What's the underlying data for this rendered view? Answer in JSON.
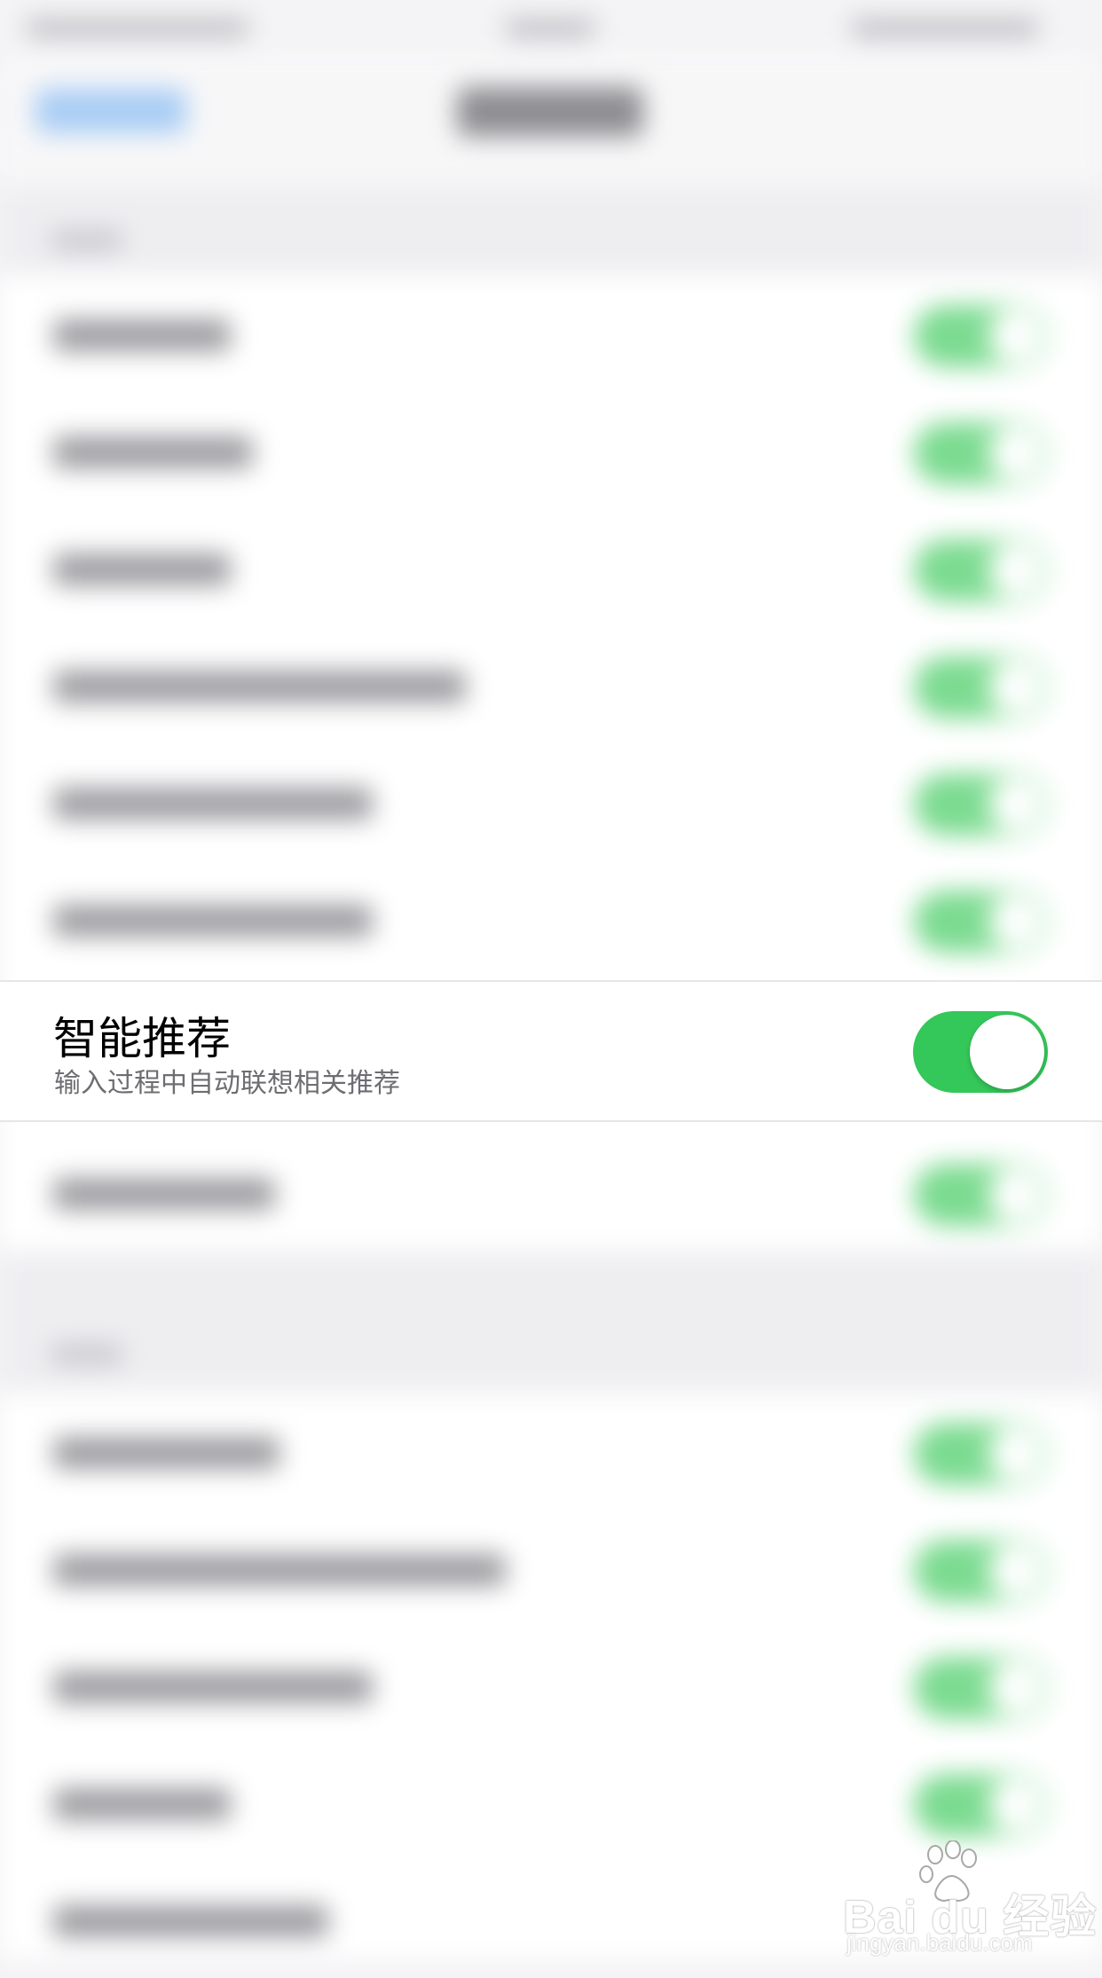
{
  "focused_setting": {
    "title": "智能推荐",
    "subtitle": "输入过程中自动联想相关推荐",
    "toggle_on": true
  },
  "colors": {
    "toggle_on": "#34c759",
    "subtitle_text": "#6d6d72",
    "background": "#f4f4f6"
  },
  "watermark": {
    "brand": "Bai du 经验",
    "url": "jingyan.baidu.com"
  },
  "icons": [
    "baidu-paw-icon"
  ]
}
